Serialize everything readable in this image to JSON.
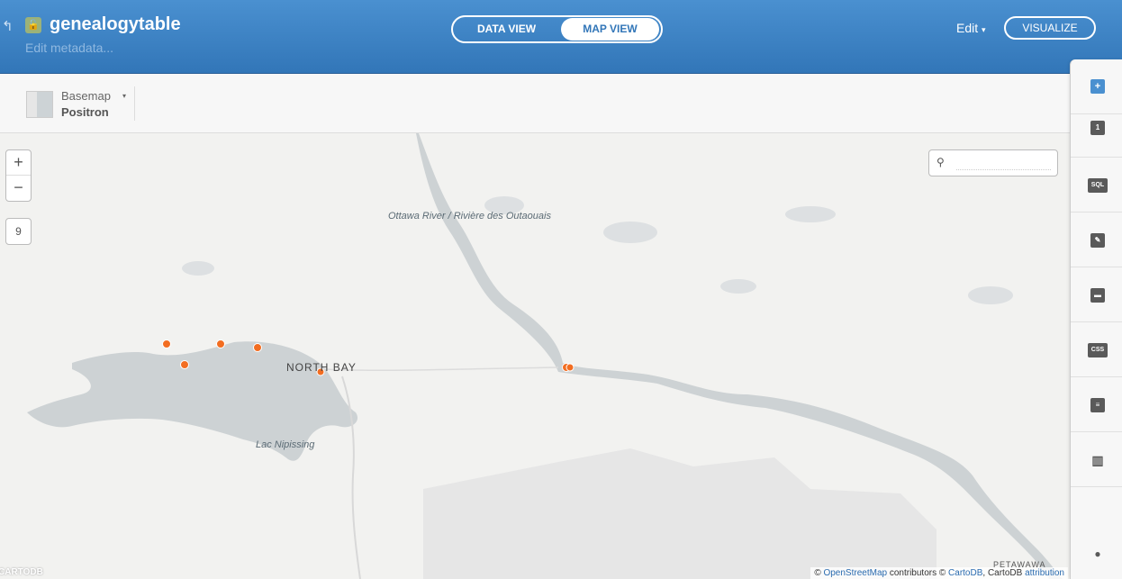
{
  "header": {
    "table_name": "genealogytable",
    "subtitle": "Edit metadata...",
    "back_glyph": "↰",
    "lock_glyph": "🔓",
    "data_view_label": "DATA VIEW",
    "map_view_label": "MAP VIEW",
    "edit_label": "Edit",
    "edit_caret": "▾",
    "visualize_label": "VISUALIZE"
  },
  "toolbar": {
    "basemap_label": "Basemap",
    "basemap_value": "Positron",
    "basemap_caret": "▾"
  },
  "map": {
    "zoom_in": "+",
    "zoom_out": "−",
    "zoom_level": "9",
    "search_placeholder": "",
    "search_icon": "magnifier-icon",
    "labels": {
      "river": "Ottawa River / Rivière des Outaouais",
      "city": "NORTH BAY",
      "lake": "Lac Nipissing",
      "town": "PETAWAWA"
    },
    "logo_text": "CARTODB",
    "attribution": {
      "prefix": "© ",
      "osm": "OpenStreetMap",
      "mid": " contributors © ",
      "cartodb": "CartoDB",
      "mid2": ", CartoDB ",
      "attr": "attribution"
    },
    "colors": {
      "water": "#cdd2d4",
      "land": "#f2f2f0",
      "point": "#f26d21",
      "park": "#e6e6e6"
    },
    "point_count": 7
  },
  "sidebar": {
    "items": [
      {
        "name": "add-layer",
        "glyph": "+"
      },
      {
        "name": "layer-1",
        "glyph": "1"
      },
      {
        "name": "sql",
        "glyph": "SQL"
      },
      {
        "name": "wizard",
        "glyph": "✎"
      },
      {
        "name": "infowindow",
        "glyph": "▬"
      },
      {
        "name": "css",
        "glyph": "CSS"
      },
      {
        "name": "legend",
        "glyph": "≡"
      },
      {
        "name": "filters",
        "glyph": "▥"
      },
      {
        "name": "annotation",
        "glyph": "●"
      }
    ]
  }
}
